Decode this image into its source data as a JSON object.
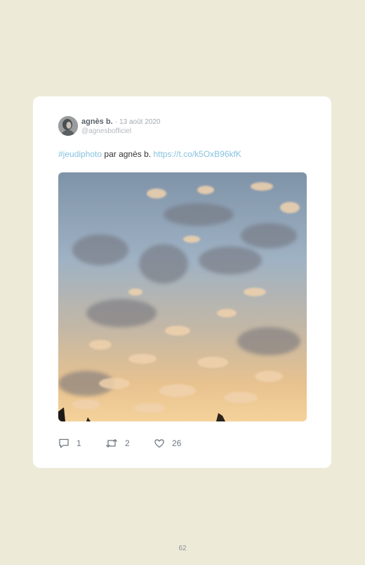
{
  "tweet": {
    "author_name": "agnès b.",
    "separator": "·",
    "date": "13 août 2020",
    "handle": "@agnesbofficiel",
    "hashtag": "#jeudiphoto",
    "text_middle": " par agnès b. ",
    "link": "https://t.co/k5OxB96kfK",
    "photo_subject": "sunset sky with scattered clouds",
    "replies": "1",
    "retweets": "2",
    "likes": "26"
  },
  "page": {
    "number": "62"
  },
  "colors": {
    "background": "#edebd8",
    "card": "#ffffff",
    "link": "#86c2de",
    "muted": "#a4aab1"
  }
}
